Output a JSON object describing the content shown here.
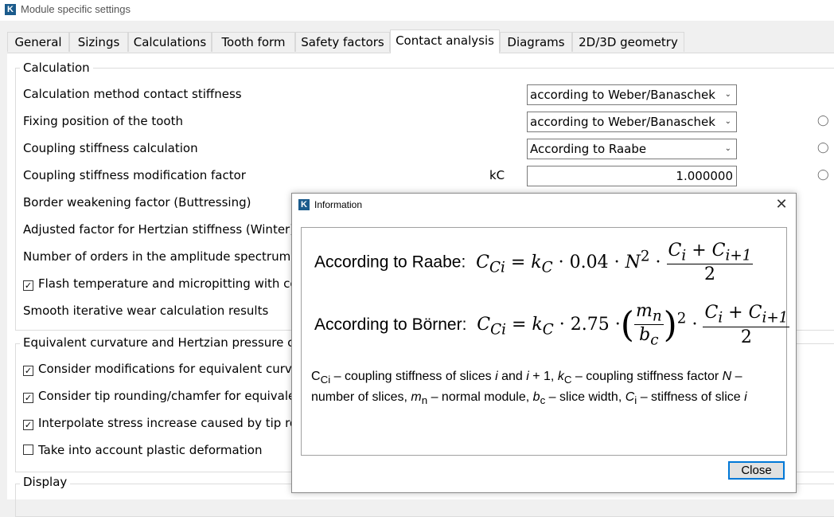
{
  "window": {
    "title": "Module specific settings"
  },
  "tabs": [
    "General",
    "Sizings",
    "Calculations",
    "Tooth form",
    "Safety factors",
    "Contact analysis",
    "Diagrams",
    "2D/3D geometry"
  ],
  "active_tab": "Contact analysis",
  "calculation": {
    "title": "Calculation",
    "method_label": "Calculation method contact stiffness",
    "method_value": "according to Weber/Banaschek",
    "fixing_label": "Fixing position of the tooth",
    "fixing_value": "according to Weber/Banaschek",
    "coupling_label": "Coupling stiffness calculation",
    "coupling_value": "According to Raabe",
    "modfactor_label": "Coupling stiffness modification factor",
    "modfactor_symbol": "kC",
    "modfactor_value": "1.000000",
    "border_label": "Border weakening factor (Buttressing)",
    "hertz_label": "Adjusted factor for Hertzian stiffness (Winter)",
    "orders_label": "Number of orders in the amplitude spectrum (tr",
    "flash_label": "Flash temperature and micropitting with coef",
    "flash_checked": true,
    "wear_label": "Smooth iterative wear calculation results"
  },
  "equivalent": {
    "title": "Equivalent curvature and Hertzian pressure calcu",
    "mods_label": "Consider modifications for equivalent curvatu",
    "mods_checked": true,
    "tip_label": "Consider tip rounding/chamfer for equivalent",
    "tip_checked": true,
    "interp_label": "Interpolate stress increase caused by tip roun",
    "interp_checked": true,
    "plastic_label": "Take into account plastic deformation",
    "plastic_checked": false
  },
  "display": {
    "title": "Display"
  },
  "dialog": {
    "title": "Information",
    "raabe_label": "According to Raabe:",
    "borner_label": "According to Börner:",
    "legend_line1": "C",
    "close_label": "Close"
  }
}
